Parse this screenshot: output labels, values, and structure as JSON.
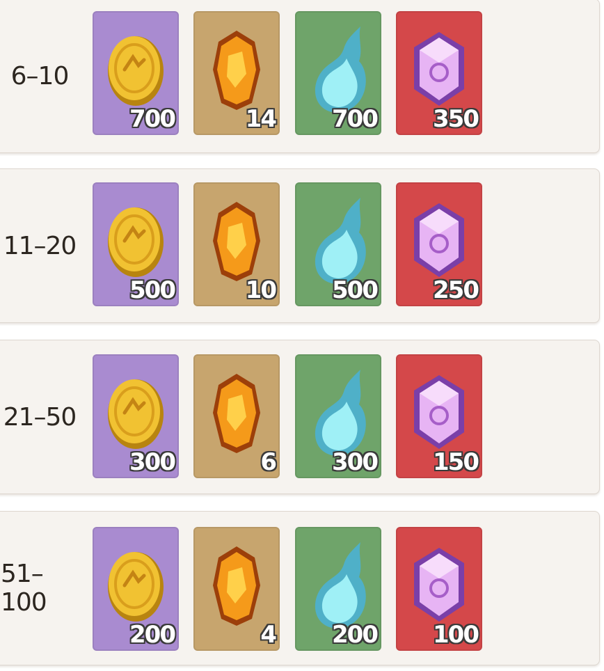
{
  "colors": {
    "coin_bg": "#a98bd0",
    "crystal_bg": "#c7a56e",
    "spirit_bg": "#6fa46a",
    "gem_bg": "#d4484a"
  },
  "items": [
    {
      "icon": "gold-coin-icon",
      "bg": "#a98bd0"
    },
    {
      "icon": "orange-crystal-icon",
      "bg": "#c7a56e"
    },
    {
      "icon": "blue-flame-icon",
      "bg": "#6fa46a"
    },
    {
      "icon": "purple-gem-icon",
      "bg": "#d4484a"
    }
  ],
  "tiers": [
    {
      "rank": "6–10",
      "rewards": [
        "700",
        "14",
        "700",
        "350"
      ]
    },
    {
      "rank": "11–20",
      "rewards": [
        "500",
        "10",
        "500",
        "250"
      ]
    },
    {
      "rank": "21–50",
      "rewards": [
        "300",
        "6",
        "300",
        "150"
      ]
    },
    {
      "rank": "51–100",
      "rewards": [
        "200",
        "4",
        "200",
        "100"
      ]
    }
  ]
}
